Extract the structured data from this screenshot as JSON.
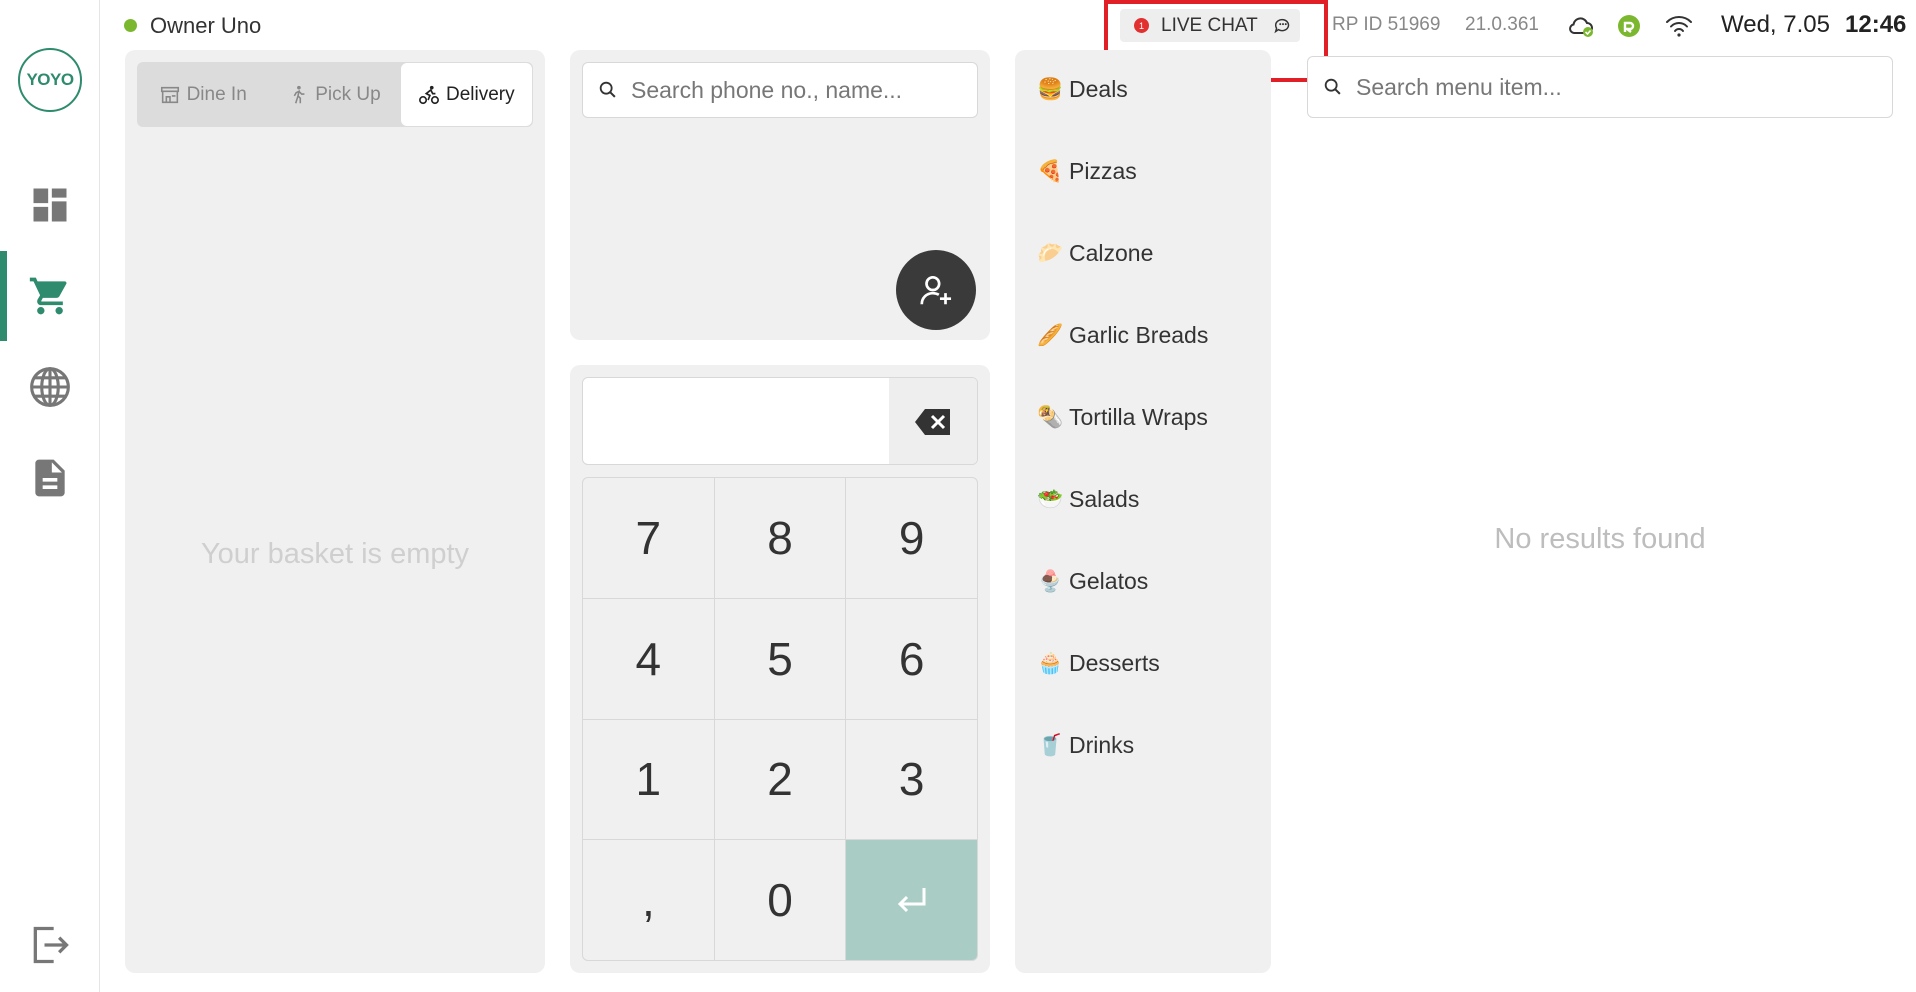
{
  "brand": {
    "logo_text": "YOYO",
    "accent": "#2e8b6e"
  },
  "header": {
    "user_name": "Owner Uno",
    "user_status_color": "#7cb82f",
    "live_chat": {
      "badge_count": "1",
      "label": "LIVE CHAT"
    },
    "rp_id": "RP ID 51969",
    "version": "21.0.361",
    "date": "Wed, 7.05",
    "time": "12:46"
  },
  "sidebar": {
    "items": [
      {
        "name": "dashboard-icon"
      },
      {
        "name": "cart-icon",
        "active": true
      },
      {
        "name": "globe-icon"
      },
      {
        "name": "document-icon"
      },
      {
        "name": "logout-icon"
      }
    ]
  },
  "basket": {
    "tabs": [
      {
        "label": "Dine In",
        "icon": "store-icon"
      },
      {
        "label": "Pick Up",
        "icon": "walking-icon"
      },
      {
        "label": "Delivery",
        "icon": "delivery-icon",
        "active": true
      }
    ],
    "empty_text": "Your basket is empty"
  },
  "customer": {
    "search_placeholder": "Search phone no., name..."
  },
  "keypad": {
    "display_value": "",
    "keys": [
      "7",
      "8",
      "9",
      "4",
      "5",
      "6",
      "1",
      "2",
      "3",
      ",",
      "0"
    ]
  },
  "categories": [
    {
      "emoji": "🍔",
      "label": "Deals"
    },
    {
      "emoji": "🍕",
      "label": "Pizzas"
    },
    {
      "emoji": "🥟",
      "label": "Calzone"
    },
    {
      "emoji": "🥖",
      "label": "Garlic Breads"
    },
    {
      "emoji": "🌯",
      "label": "Tortilla Wraps"
    },
    {
      "emoji": "🥗",
      "label": "Salads"
    },
    {
      "emoji": "🍨",
      "label": "Gelatos"
    },
    {
      "emoji": "🧁",
      "label": "Desserts"
    },
    {
      "emoji": "🥤",
      "label": "Drinks"
    }
  ],
  "menu": {
    "search_placeholder": "Search menu item...",
    "no_results_text": "No results found"
  }
}
